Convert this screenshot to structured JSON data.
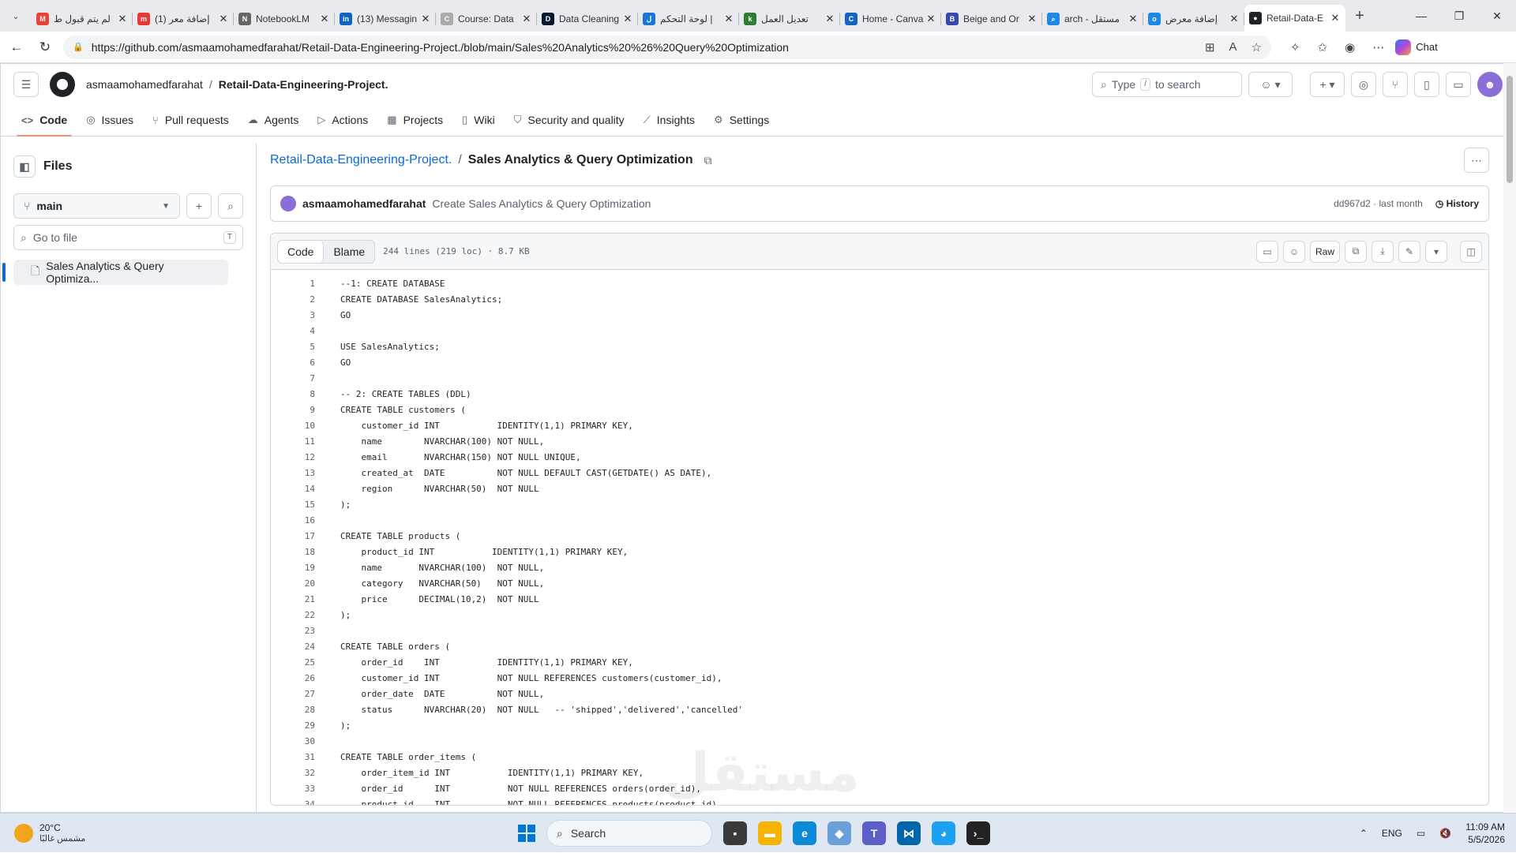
{
  "browser": {
    "tabs": [
      {
        "label": "لم يتم قبول ط",
        "icon": "gmail-icon",
        "color": "#ea4335",
        "glyph": "M"
      },
      {
        "label": "(1) إضافة معر",
        "icon": "mostaql-icon",
        "color": "#e53935",
        "glyph": "m"
      },
      {
        "label": "NotebookLM",
        "icon": "notebooklm-icon",
        "color": "#666666",
        "glyph": "N"
      },
      {
        "label": "(13) Messagin",
        "icon": "linkedin-icon",
        "color": "#0a66c2",
        "glyph": "in"
      },
      {
        "label": "Course: Data",
        "icon": "course-icon",
        "color": "#aaaaaa",
        "glyph": "C"
      },
      {
        "label": "Data Cleaning",
        "icon": "datacamp-icon",
        "color": "#05192d",
        "glyph": "D"
      },
      {
        "label": "لوحة التحكم |",
        "icon": "dashboard-icon",
        "color": "#1976d2",
        "glyph": "ل"
      },
      {
        "label": "تعديل العمل",
        "icon": "khamsat-icon",
        "color": "#2e7d32",
        "glyph": "k"
      },
      {
        "label": "Home - Canva",
        "icon": "canva-icon",
        "color": "#1565c0",
        "glyph": "C"
      },
      {
        "label": "Beige and Or",
        "icon": "canva-doc-icon",
        "color": "#3949ab",
        "glyph": "B"
      },
      {
        "label": "arch - مستقل",
        "icon": "search-tab-icon",
        "color": "#1e88e5",
        "glyph": "⌕"
      },
      {
        "label": "إضافة معرض",
        "icon": "mostaql-blue-icon",
        "color": "#1e88e5",
        "glyph": "o"
      },
      {
        "label": "Retail-Data-E",
        "icon": "github-tab-icon",
        "color": "#1f2328",
        "glyph": "●",
        "active": true
      }
    ],
    "url": "https://github.com/asmaamohamedfarahat/Retail-Data-Engineering-Project./blob/main/Sales%20Analytics%20%26%20Query%20Optimization",
    "chat_label": "Chat"
  },
  "header": {
    "owner": "asmaamohamedfarahat",
    "repo": "Retail-Data-Engineering-Project.",
    "search_pre": "Type",
    "search_key": "/",
    "search_post": "to search"
  },
  "repo_nav": [
    {
      "label": "Code",
      "icon": "code-icon",
      "glyph": "<>",
      "active": true
    },
    {
      "label": "Issues",
      "icon": "issues-icon",
      "glyph": "◎"
    },
    {
      "label": "Pull requests",
      "icon": "pull-request-icon",
      "glyph": "⑂"
    },
    {
      "label": "Agents",
      "icon": "agents-icon",
      "glyph": "☁"
    },
    {
      "label": "Actions",
      "icon": "actions-icon",
      "glyph": "▷"
    },
    {
      "label": "Projects",
      "icon": "projects-icon",
      "glyph": "▦"
    },
    {
      "label": "Wiki",
      "icon": "wiki-icon",
      "glyph": "▯"
    },
    {
      "label": "Security and quality",
      "icon": "shield-icon",
      "glyph": "⛉"
    },
    {
      "label": "Insights",
      "icon": "insights-icon",
      "glyph": "⟋"
    },
    {
      "label": "Settings",
      "icon": "gear-icon",
      "glyph": "⚙"
    }
  ],
  "sidebar": {
    "title": "Files",
    "branch": "main",
    "goto_placeholder": "Go to file",
    "goto_key": "T",
    "file": "Sales Analytics & Query Optimiza..."
  },
  "file": {
    "repo_link": "Retail-Data-Engineering-Project.",
    "name": "Sales Analytics & Query Optimization",
    "commit_author": "asmaamohamedfarahat",
    "commit_message": "Create Sales Analytics & Query Optimization",
    "commit_meta": "dd967d2 · last month",
    "history_label": "History",
    "tab_code": "Code",
    "tab_blame": "Blame",
    "stats": "244 lines (219 loc) · 8.7 KB",
    "raw_label": "Raw"
  },
  "code_lines": [
    "--1: CREATE DATABASE",
    "CREATE DATABASE SalesAnalytics;",
    "GO",
    "",
    "USE SalesAnalytics;",
    "GO",
    "",
    "-- 2: CREATE TABLES (DDL)",
    "CREATE TABLE customers (",
    "    customer_id INT           IDENTITY(1,1) PRIMARY KEY,",
    "    name        NVARCHAR(100) NOT NULL,",
    "    email       NVARCHAR(150) NOT NULL UNIQUE,",
    "    created_at  DATE          NOT NULL DEFAULT CAST(GETDATE() AS DATE),",
    "    region      NVARCHAR(50)  NOT NULL",
    ");",
    "",
    "CREATE TABLE products (",
    "    product_id INT           IDENTITY(1,1) PRIMARY KEY,",
    "    name       NVARCHAR(100)  NOT NULL,",
    "    category   NVARCHAR(50)   NOT NULL,",
    "    price      DECIMAL(10,2)  NOT NULL",
    ");",
    "",
    "CREATE TABLE orders (",
    "    order_id    INT           IDENTITY(1,1) PRIMARY KEY,",
    "    customer_id INT           NOT NULL REFERENCES customers(customer_id),",
    "    order_date  DATE          NOT NULL,",
    "    status      NVARCHAR(20)  NOT NULL   -- 'shipped','delivered','cancelled'",
    ");",
    "",
    "CREATE TABLE order_items (",
    "    order_item_id INT           IDENTITY(1,1) PRIMARY KEY,",
    "    order_id      INT           NOT NULL REFERENCES orders(order_id),",
    "    product_id    INT           NOT NULL REFERENCES products(product_id),"
  ],
  "taskbar": {
    "temp": "20°C",
    "weather": "مشمس غالبًا",
    "search": "Search",
    "lang": "ENG",
    "time": "11:09 AM",
    "date": "5/5/2026"
  },
  "watermark": {
    "main": "مستقل",
    "sub": "mostaql.com"
  }
}
